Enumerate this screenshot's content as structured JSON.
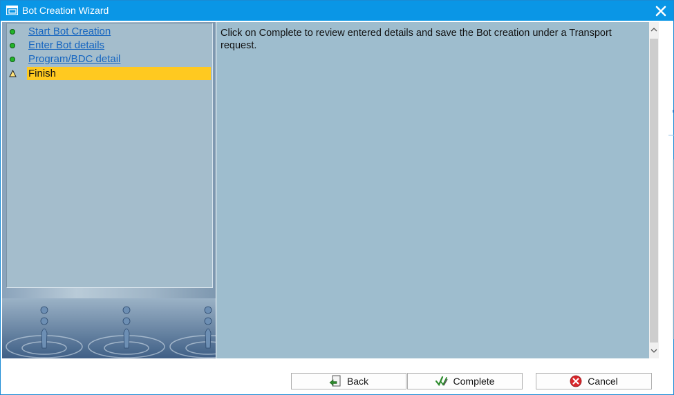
{
  "window": {
    "title": "Bot Creation Wizard"
  },
  "steps": [
    {
      "label": "Start Bot Creation",
      "status": "done"
    },
    {
      "label": "Enter Bot details",
      "status": "done"
    },
    {
      "label": "Program/BDC detail",
      "status": "done"
    },
    {
      "label": "Finish",
      "status": "current"
    }
  ],
  "content": {
    "message": "Click on Complete to review entered details and save the Bot creation under a Transport request."
  },
  "buttons": {
    "back": "Back",
    "complete": "Complete",
    "cancel": "Cancel"
  },
  "colors": {
    "titlebar": "#0a96e6",
    "content_bg": "#9ebdce",
    "active_step": "#ffc920",
    "link": "#1565c0",
    "status_done": "#22b32a"
  },
  "icons": {
    "window": "window-icon",
    "close": "close-icon",
    "done": "green-dot-icon",
    "current": "warning-triangle-icon",
    "back": "back-arrow-icon",
    "complete": "checkmark-icon",
    "cancel": "cancel-x-icon"
  }
}
